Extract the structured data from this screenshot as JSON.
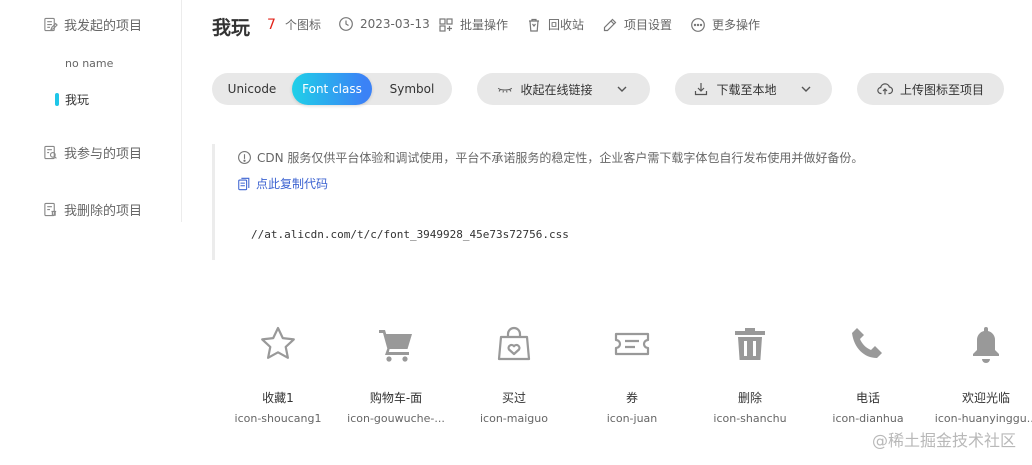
{
  "sidebar": {
    "my_projects": "我发起的项目",
    "sub_items": [
      "no name",
      "我玩"
    ],
    "joined_projects": "我参与的项目",
    "deleted_projects": "我删除的项目"
  },
  "header": {
    "title": "我玩",
    "icon_count": "7",
    "icon_count_unit": "个图标",
    "date": "2023-03-13",
    "batch": "批量操作",
    "recycle": "回收站",
    "settings": "项目设置",
    "more": "更多操作"
  },
  "toolbar": {
    "tabs": [
      "Unicode",
      "Font class",
      "Symbol"
    ],
    "active_tab": "Font class",
    "collapse_link": "收起在线链接",
    "download": "下载至本地",
    "upload": "上传图标至项目"
  },
  "cdn": {
    "notice": "CDN 服务仅供平台体验和调试使用，平台不承诺服务的稳定性，企业客户需下载字体包自行发布使用并做好备份。",
    "copy_code": "点此复制代码",
    "url": "//at.alicdn.com/t/c/font_3949928_45e73s72756.css"
  },
  "icons": [
    {
      "name": "收藏1",
      "code": "icon-shoucang1",
      "icon": "star-icon"
    },
    {
      "name": "购物车-面",
      "code": "icon-gouwuche-...",
      "icon": "cart-icon"
    },
    {
      "name": "买过",
      "code": "icon-maiguo",
      "icon": "shopping-bag-icon"
    },
    {
      "name": "券",
      "code": "icon-juan",
      "icon": "ticket-icon"
    },
    {
      "name": "删除",
      "code": "icon-shanchu",
      "icon": "trash-icon"
    },
    {
      "name": "电话",
      "code": "icon-dianhua",
      "icon": "phone-icon"
    },
    {
      "name": "欢迎光临",
      "code": "icon-huanyinggu...",
      "icon": "bell-icon"
    }
  ],
  "watermark": "@稀土掘金技术社区",
  "colors": {
    "accent_start": "#1fd0e8",
    "accent_end": "#3b82f6",
    "count_red": "#e2231a",
    "link_blue": "#3c63d1",
    "icon_gray": "#999999"
  }
}
